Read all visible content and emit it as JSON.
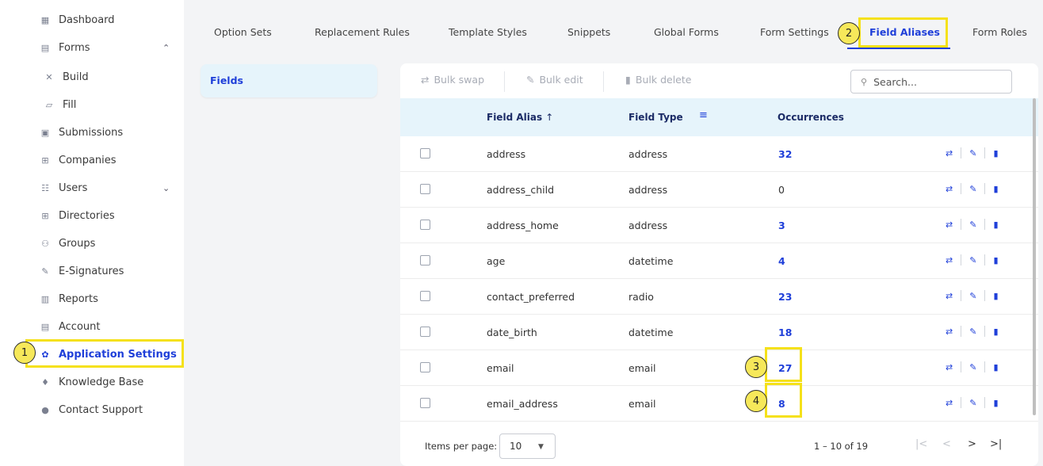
{
  "sidebar": {
    "items": [
      {
        "label": "Dashboard",
        "icon": "dashboard-icon",
        "glyph": "▦"
      },
      {
        "label": "Forms",
        "icon": "forms-icon",
        "glyph": "▤",
        "chevron": "⌃"
      },
      {
        "label": "Build",
        "icon": "build-icon",
        "glyph": "✕"
      },
      {
        "label": "Fill",
        "icon": "fill-icon",
        "glyph": "▱"
      },
      {
        "label": "Submissions",
        "icon": "submissions-icon",
        "glyph": "▣"
      },
      {
        "label": "Companies",
        "icon": "companies-icon",
        "glyph": "⊞"
      },
      {
        "label": "Users",
        "icon": "users-icon",
        "glyph": "☷",
        "chevron": "⌄"
      },
      {
        "label": "Directories",
        "icon": "directories-icon",
        "glyph": "⊞"
      },
      {
        "label": "Groups",
        "icon": "groups-icon",
        "glyph": "⚇"
      },
      {
        "label": "E-Signatures",
        "icon": "e-signatures-icon",
        "glyph": "✎"
      },
      {
        "label": "Reports",
        "icon": "reports-icon",
        "glyph": "▥"
      },
      {
        "label": "Account",
        "icon": "account-icon",
        "glyph": "▤"
      },
      {
        "label": "Application Settings",
        "icon": "gear-icon",
        "glyph": "✿"
      },
      {
        "label": "Knowledge Base",
        "icon": "graduation-cap-icon",
        "glyph": "♦"
      },
      {
        "label": "Contact Support",
        "icon": "support-icon",
        "glyph": "●"
      }
    ]
  },
  "tabs": [
    "Option Sets",
    "Replacement Rules",
    "Template Styles",
    "Snippets",
    "Global Forms",
    "Form Settings",
    "Field Aliases",
    "Form Roles"
  ],
  "active_tab": "Field Aliases",
  "left_pane": {
    "label": "Fields"
  },
  "toolbar": {
    "bulk_swap": "Bulk swap",
    "bulk_edit": "Bulk edit",
    "bulk_delete": "Bulk delete",
    "search_placeholder": "Search..."
  },
  "table": {
    "columns": [
      "Field Alias",
      "Field Type",
      "Occurrences"
    ],
    "rows": [
      {
        "alias": "address",
        "type": "address",
        "occurrences": "32"
      },
      {
        "alias": "address_child",
        "type": "address",
        "occurrences": "0"
      },
      {
        "alias": "address_home",
        "type": "address",
        "occurrences": "3"
      },
      {
        "alias": "age",
        "type": "datetime",
        "occurrences": "4"
      },
      {
        "alias": "contact_preferred",
        "type": "radio",
        "occurrences": "23"
      },
      {
        "alias": "date_birth",
        "type": "datetime",
        "occurrences": "18"
      },
      {
        "alias": "email",
        "type": "email",
        "occurrences": "27"
      },
      {
        "alias": "email_address",
        "type": "email",
        "occurrences": "8"
      }
    ]
  },
  "pagination": {
    "items_per_page_label": "Items per page:",
    "items_per_page": "10",
    "range": "1 – 10 of 19"
  },
  "callouts": [
    "1",
    "2",
    "3",
    "4"
  ],
  "colors": {
    "accent": "#1f3fd9",
    "highlight": "#f5e11a",
    "header_bg": "#e6f4fb"
  }
}
